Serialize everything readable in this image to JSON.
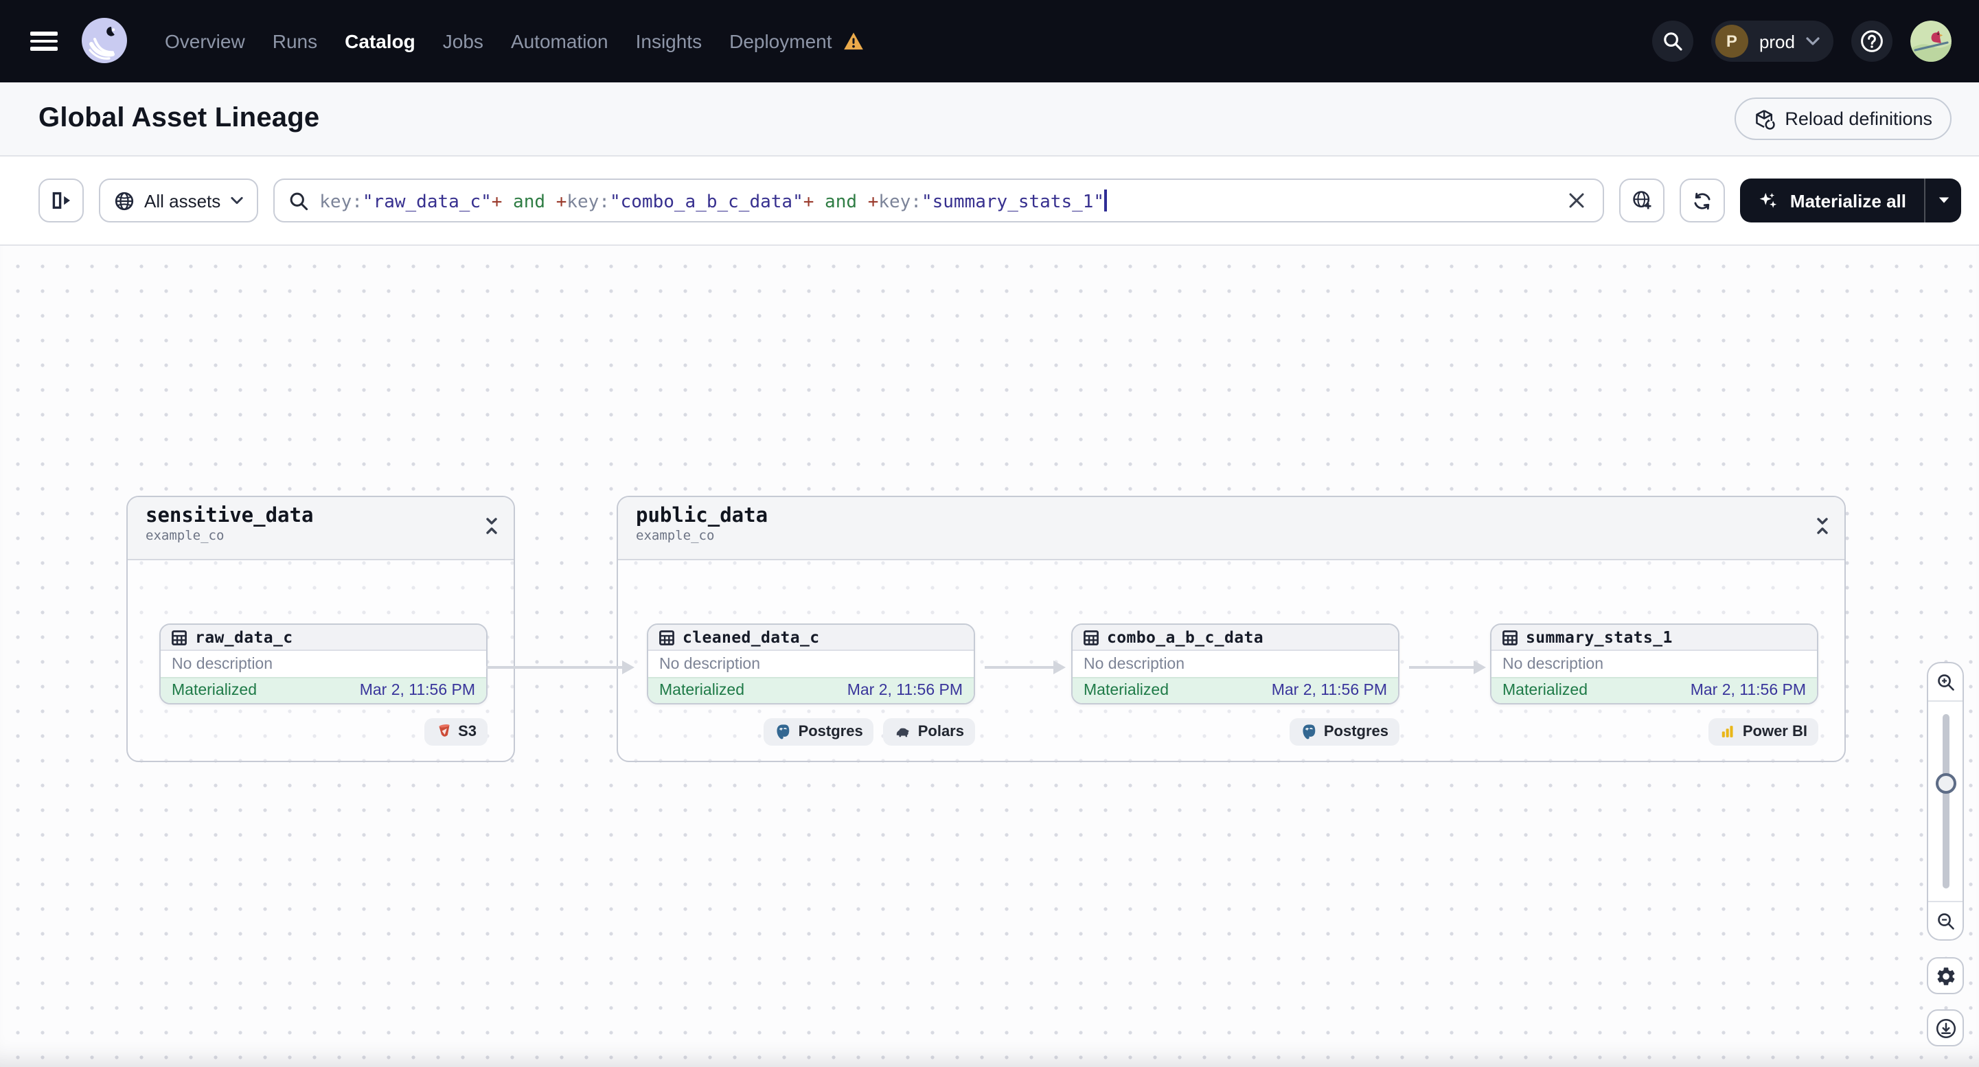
{
  "nav": {
    "items": [
      {
        "label": "Overview",
        "active": false
      },
      {
        "label": "Runs",
        "active": false
      },
      {
        "label": "Catalog",
        "active": true
      },
      {
        "label": "Jobs",
        "active": false
      },
      {
        "label": "Automation",
        "active": false
      },
      {
        "label": "Insights",
        "active": false
      },
      {
        "label": "Deployment",
        "active": false,
        "warning": true
      }
    ],
    "deployment_switcher": {
      "initial": "P",
      "label": "prod"
    }
  },
  "header": {
    "title": "Global Asset Lineage",
    "reload_label": "Reload definitions"
  },
  "toolbar": {
    "filter_label": "All assets",
    "materialize_label": "Materialize all",
    "query": {
      "tokens": [
        {
          "t": "key:"
        },
        {
          "t": "\"raw_data_c\""
        },
        {
          "t": "+"
        },
        {
          "t": " and "
        },
        {
          "t": "+"
        },
        {
          "t": "key:"
        },
        {
          "t": "\"combo_a_b_c_data\""
        },
        {
          "t": "+"
        },
        {
          "t": " and "
        },
        {
          "t": "+"
        },
        {
          "t": "key:"
        },
        {
          "t": "\"summary_stats_1\""
        }
      ]
    }
  },
  "graph": {
    "groups": [
      {
        "name": "sensitive_data",
        "repo": "example_co",
        "nodes": [
          {
            "name": "raw_data_c",
            "description": "No description",
            "status": "Materialized",
            "date": "Mar 2, 11:56 PM",
            "tags": [
              {
                "label": "S3",
                "icon": "s3-bucket-icon"
              }
            ]
          }
        ]
      },
      {
        "name": "public_data",
        "repo": "example_co",
        "nodes": [
          {
            "name": "cleaned_data_c",
            "description": "No description",
            "status": "Materialized",
            "date": "Mar 2, 11:56 PM",
            "tags": [
              {
                "label": "Postgres",
                "icon": "postgres-icon"
              },
              {
                "label": "Polars",
                "icon": "polars-icon"
              }
            ]
          },
          {
            "name": "combo_a_b_c_data",
            "description": "No description",
            "status": "Materialized",
            "date": "Mar 2, 11:56 PM",
            "tags": [
              {
                "label": "Postgres",
                "icon": "postgres-icon"
              }
            ]
          },
          {
            "name": "summary_stats_1",
            "description": "No description",
            "status": "Materialized",
            "date": "Mar 2, 11:56 PM",
            "tags": [
              {
                "label": "Power BI",
                "icon": "powerbi-icon"
              }
            ]
          }
        ]
      }
    ]
  },
  "colors": {
    "navbar_bg": "#0c0e17",
    "accent_dark": "#10141f",
    "materialized_green": "#1e7a47",
    "materialized_bg": "#e2f3e9",
    "date_indigo": "#39359b",
    "query_value": "#37308f",
    "query_plus": "#9a3a2c",
    "query_and": "#2f7d44",
    "warning_orange": "#ebaa4b",
    "edge_gray": "#d3d6dd"
  }
}
